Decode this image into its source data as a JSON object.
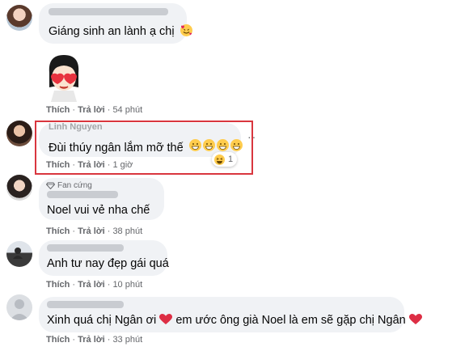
{
  "comments": [
    {
      "name": "",
      "text": "Giáng sinh an lành ạ chị",
      "emoji": "smiling-face-with-hearts"
    },
    {
      "name": "",
      "sticker": "girl-heart-eyes-sticker",
      "like": "Thích",
      "reply": "Trả lời",
      "time": "54 phút"
    },
    {
      "name": "Linh Nguyen",
      "text": "Đùi thúy ngân lắm mỡ thế",
      "emoji": "grinning-face x4",
      "like": "Thích",
      "reply": "Trả lời",
      "time": "1 giờ",
      "reaction_count": "1",
      "reaction_emoji": "laughing-face"
    },
    {
      "name": "",
      "badge": "Fan cứng",
      "text": "Noel vui vẻ nha chế",
      "like": "Thích",
      "reply": "Trả lời",
      "time": "38 phút"
    },
    {
      "name": "",
      "text": "Anh tư nay đẹp gái quá",
      "like": "Thích",
      "reply": "Trả lời",
      "time": "10 phút"
    },
    {
      "name": "",
      "text_a": "Xinh quá chị Ngân ơi",
      "text_b": "em ước ông già Noel là em sẽ gặp chị Ngân",
      "like": "Thích",
      "reply": "Trả lời",
      "time": "33 phút"
    }
  ],
  "separator": "·",
  "colors": {
    "highlight": "#d9363e",
    "bubble": "#f0f2f5",
    "meta": "#65676b",
    "heart": "#e0245e"
  }
}
